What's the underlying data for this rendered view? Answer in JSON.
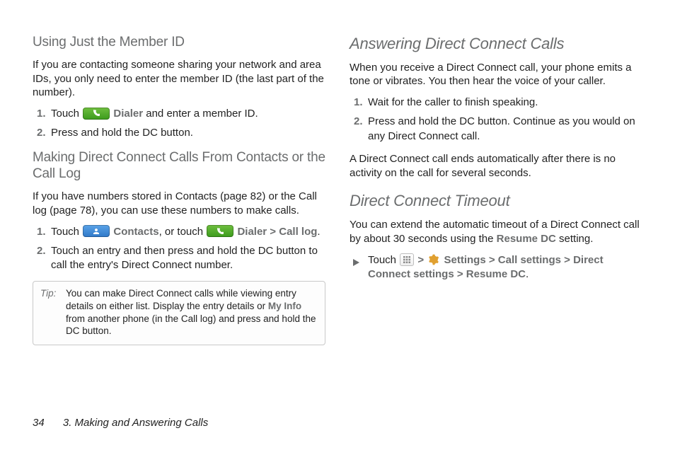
{
  "left": {
    "h1": "Using Just the Member ID",
    "p1": "If you are contacting someone sharing your network and area IDs, you only need to enter the member ID (the last part of the number).",
    "s1a": "Touch ",
    "s1_dialer": "Dialer",
    "s1b": " and enter a member ID.",
    "s2": "Press and hold the DC button.",
    "h2": "Making Direct Connect Calls From Contacts or the Call Log",
    "p2": "If you have numbers stored in Contacts (page 82) or the Call log (page 78), you can use these numbers to make calls.",
    "s3a": "Touch ",
    "s3_contacts": "Contacts",
    "s3b": ", or touch ",
    "s3_dialer": "Dialer",
    "s3_gt": " > ",
    "s3_calllog": "Call log",
    "s3_dot": ".",
    "s4": "Touch an entry and then press and hold the DC button to call the entry's Direct Connect number.",
    "tip_label": "Tip:",
    "tip_a": "You can make Direct Connect calls while viewing entry details on either list. Display the entry details or ",
    "tip_myinfo": "My Info",
    "tip_b": " from another phone (in the Call log) and press and hold the DC button."
  },
  "right": {
    "h1": "Answering Direct Connect Calls",
    "p1": "When you receive a Direct Connect call, your phone emits a tone or vibrates. You then hear the voice of your caller.",
    "s1": "Wait for the caller to finish speaking.",
    "s2": "Press and hold the DC button. Continue as you would on any Direct Connect call.",
    "p2": "A Direct Connect call ends automatically after there is no activity on the call for several seconds.",
    "h2": "Direct Connect Timeout",
    "p3a": "You can extend the automatic timeout of a Direct Connect call by about 30 seconds using the ",
    "p3_resume": "Resume DC",
    "p3b": " setting.",
    "b1a": "Touch ",
    "b1_gt1": " > ",
    "b1_settings": "Settings",
    "b1_gt2": " > ",
    "b1_call": "Call settings",
    "b1_gt3": " > ",
    "b1_dc": "Direct Connect settings",
    "b1_gt4": " > ",
    "b1_resume": "Resume DC",
    "b1_dot": "."
  },
  "footer": {
    "page": "34",
    "chapter": "3. Making and Answering Calls"
  }
}
